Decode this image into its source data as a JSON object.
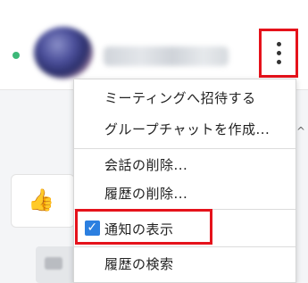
{
  "header": {
    "presence_color": "#3cb878",
    "contact_name_blurred": "",
    "more_icon": "vertical-ellipsis-icon"
  },
  "menu": {
    "items": [
      {
        "label": "ミーティングへ招待する"
      },
      {
        "label": "グループチャットを作成..."
      },
      {
        "label": "会話の削除..."
      },
      {
        "label": "履歴の削除..."
      },
      {
        "label": "通知の表示",
        "checked": true
      },
      {
        "label": "履歴の検索"
      }
    ]
  },
  "chat": {
    "like_icon": "thumbs-up-icon",
    "like_glyph": "👍"
  },
  "annotations": {
    "highlight_color": "#e5121b"
  },
  "check_glyph": "✓",
  "scroll_caret_glyph": "^"
}
